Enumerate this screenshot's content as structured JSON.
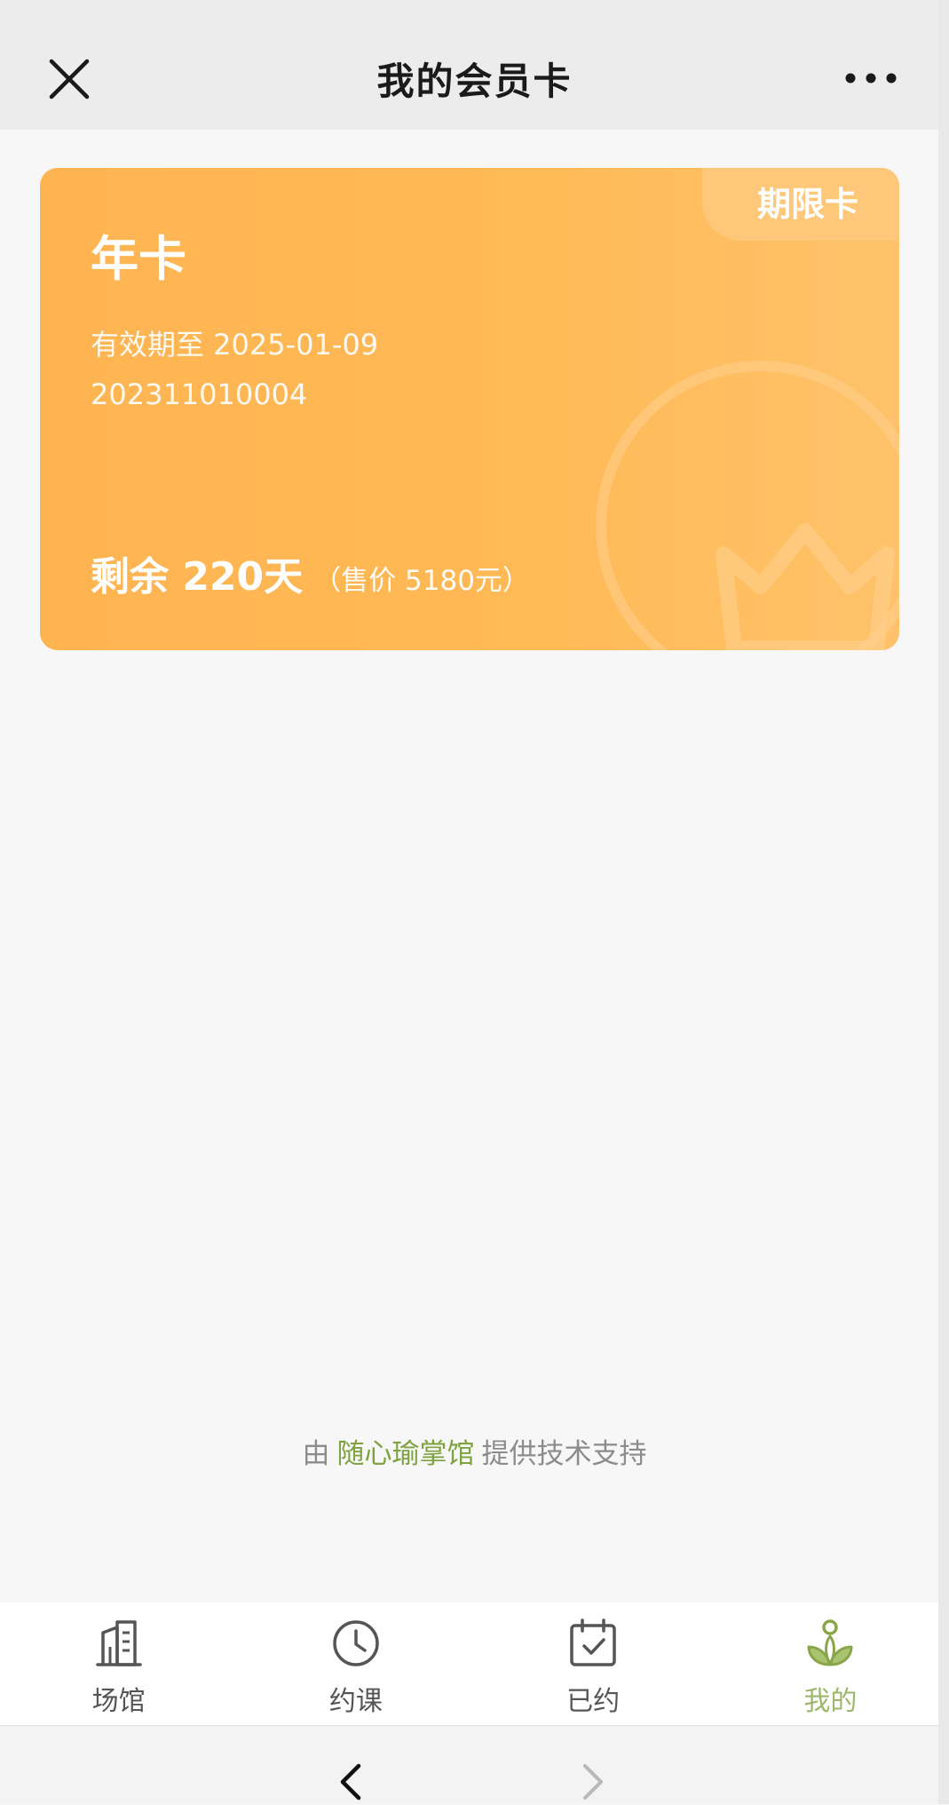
{
  "header": {
    "title": "我的会员卡",
    "close_icon": "close-icon",
    "more_icon": "more-dots-icon"
  },
  "card": {
    "badge": "期限卡",
    "title": "年卡",
    "expiry": "有效期至 2025-01-09",
    "number": "202311010004",
    "remaining": "剩余 220天",
    "price": "（售价 5180元）",
    "decoration_icon": "crown-icon",
    "accent_color": "#ffb452"
  },
  "credit": {
    "prefix": "由",
    "brand": "随心瑜掌馆",
    "suffix": "提供技术支持",
    "brand_color": "#7ea23f"
  },
  "tabbar": {
    "items": [
      {
        "label": "场馆",
        "icon": "building-icon",
        "active": false
      },
      {
        "label": "约课",
        "icon": "clock-icon",
        "active": false
      },
      {
        "label": "已约",
        "icon": "calendar-check-icon",
        "active": false
      },
      {
        "label": "我的",
        "icon": "profile-leaf-icon",
        "active": true
      }
    ],
    "active_color": "#9db76b"
  },
  "browser": {
    "back_icon": "chevron-left-icon",
    "forward_icon": "chevron-right-icon"
  }
}
